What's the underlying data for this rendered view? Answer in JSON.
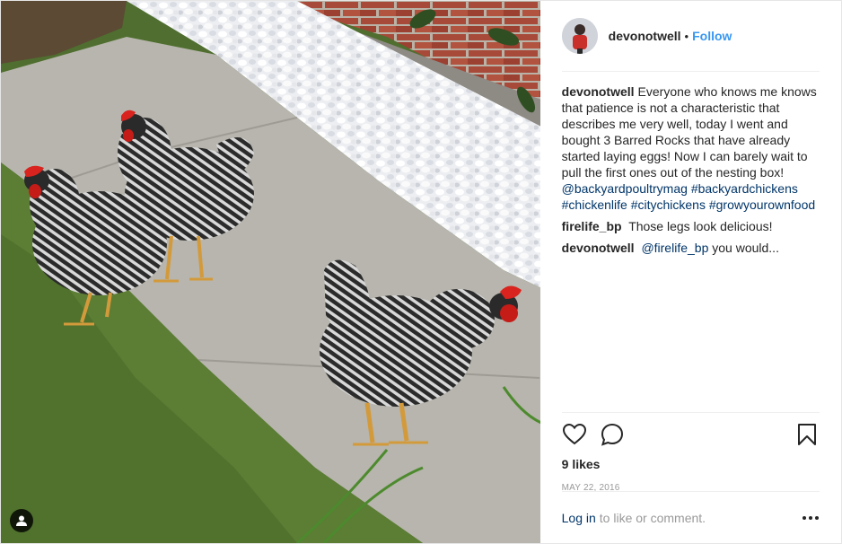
{
  "header": {
    "username": "devonotwell",
    "separator": "•",
    "follow_label": "Follow",
    "avatar_icon": "user-avatar"
  },
  "comments": [
    {
      "username": "devonotwell",
      "text": "Everyone who knows me knows that patience is not a characteristic that describes me very well, today I went and bought 3 Barred Rocks that have already started laying eggs! Now I can barely wait to pull the first ones out of the nesting box!",
      "hashtags": [
        "@backyardpoultrymag",
        "#backyardchickens",
        "#chickenlife",
        "#citychickens",
        "#growyourownfood"
      ]
    },
    {
      "username": "firelife_bp",
      "text": "Those legs look delicious!"
    },
    {
      "username": "devonotwell",
      "mention": "@firelife_bp",
      "text": "you would..."
    }
  ],
  "actions": {
    "like_icon": "heart-icon",
    "comment_icon": "comment-bubble-icon",
    "save_icon": "bookmark-icon"
  },
  "likes": "9 likes",
  "date": "MAY 22, 2016",
  "login": {
    "link": "Log in",
    "text": "to like or comment.",
    "more_icon": "more-dots-icon"
  },
  "photo": {
    "tag_icon": "user-tag-icon"
  },
  "colors": {
    "link_blue": "#3897f0",
    "hashtag": "#003569",
    "muted": "#999999",
    "divider": "#efefef"
  }
}
